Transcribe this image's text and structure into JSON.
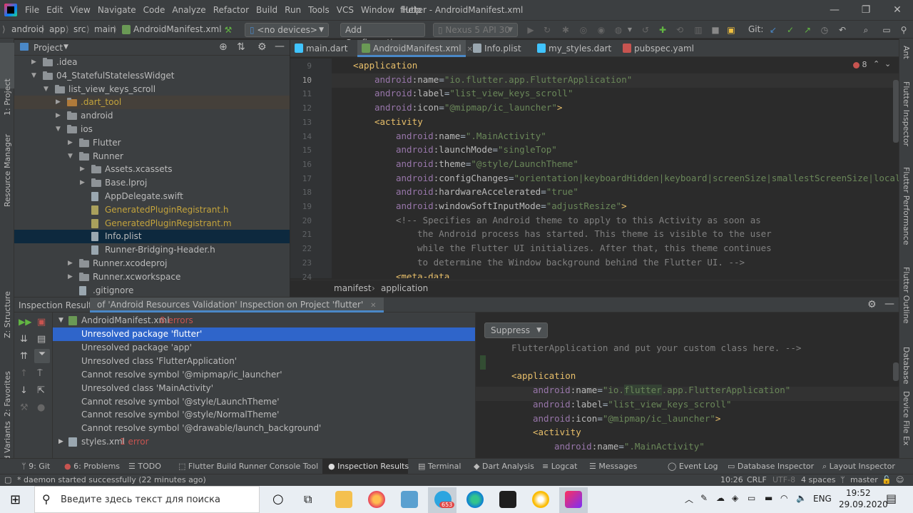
{
  "menubar": {
    "items": [
      "File",
      "Edit",
      "View",
      "Navigate",
      "Code",
      "Analyze",
      "Refactor",
      "Build",
      "Run",
      "Tools",
      "VCS",
      "Window",
      "Help"
    ],
    "title": "flutter - AndroidManifest.xml"
  },
  "navbar": {
    "breadcrumbs": [
      "android",
      "app",
      "src",
      "main",
      "AndroidManifest.xml"
    ],
    "device_select": "<no devices>",
    "add_configuration": "Add Configuration...",
    "emulator": "Nexus 5 API 30",
    "git_label": "Git:"
  },
  "left_strip": {
    "project": "1: Project",
    "resource_manager": "Resource Manager",
    "structure": "Z: Structure",
    "favorites": "2: Favorites",
    "build_variants": "Build Variants"
  },
  "right_strip": {
    "ant": "Ant",
    "flutter_inspector": "Flutter Inspector",
    "flutter_performance": "Flutter Performance",
    "flutter_outline": "Flutter Outline",
    "database": "Database",
    "device_file_explorer": "Device File Ex"
  },
  "project_panel": {
    "title": "Project",
    "tree": [
      {
        "label": ".idea",
        "indent": 0,
        "arrow": ">",
        "type": "folder"
      },
      {
        "label": "04_StatefulStatelessWidget",
        "indent": 0,
        "arrow": "v",
        "type": "folder"
      },
      {
        "label": "list_view_keys_scroll",
        "indent": 1,
        "arrow": "v",
        "type": "folder"
      },
      {
        "label": ".dart_tool",
        "indent": 2,
        "arrow": ">",
        "type": "folder-orange"
      },
      {
        "label": "android",
        "indent": 2,
        "arrow": ">",
        "type": "folder"
      },
      {
        "label": "ios",
        "indent": 2,
        "arrow": "v",
        "type": "folder"
      },
      {
        "label": "Flutter",
        "indent": 3,
        "arrow": ">",
        "type": "folder"
      },
      {
        "label": "Runner",
        "indent": 3,
        "arrow": "v",
        "type": "folder"
      },
      {
        "label": "Assets.xcassets",
        "indent": 4,
        "arrow": ">",
        "type": "folder"
      },
      {
        "label": "Base.lproj",
        "indent": 4,
        "arrow": ">",
        "type": "folder"
      },
      {
        "label": "AppDelegate.swift",
        "indent": 4,
        "arrow": "",
        "type": "file"
      },
      {
        "label": "GeneratedPluginRegistrant.h",
        "indent": 4,
        "arrow": "",
        "type": "file-yellow"
      },
      {
        "label": "GeneratedPluginRegistrant.m",
        "indent": 4,
        "arrow": "",
        "type": "file-yellow"
      },
      {
        "label": "Info.plist",
        "indent": 4,
        "arrow": "",
        "type": "file-selected"
      },
      {
        "label": "Runner-Bridging-Header.h",
        "indent": 4,
        "arrow": "",
        "type": "file"
      },
      {
        "label": "Runner.xcodeproj",
        "indent": 3,
        "arrow": ">",
        "type": "folder"
      },
      {
        "label": "Runner.xcworkspace",
        "indent": 3,
        "arrow": ">",
        "type": "folder"
      },
      {
        "label": ".gitignore",
        "indent": 3,
        "arrow": "",
        "type": "file"
      }
    ]
  },
  "editor_tabs": [
    {
      "label": "main.dart",
      "active": false
    },
    {
      "label": "AndroidManifest.xml",
      "active": true
    },
    {
      "label": "Info.plist",
      "active": false
    },
    {
      "label": "my_styles.dart",
      "active": false
    },
    {
      "label": "pubspec.yaml",
      "active": false
    }
  ],
  "error_count": "8",
  "code_lines": [
    {
      "n": "9",
      "indent": 1,
      "parts": [
        [
          "tag",
          "<application"
        ]
      ]
    },
    {
      "n": "10",
      "indent": 2,
      "parts": [
        [
          "ns",
          "android"
        ],
        [
          "attr",
          ":name"
        ],
        [
          "plain",
          "="
        ],
        [
          "val",
          "\"io.flutter.app.FlutterApplication\""
        ]
      ]
    },
    {
      "n": "11",
      "indent": 2,
      "parts": [
        [
          "ns",
          "android"
        ],
        [
          "attr",
          ":label"
        ],
        [
          "plain",
          "="
        ],
        [
          "val",
          "\"list_view_keys_scroll\""
        ]
      ]
    },
    {
      "n": "12",
      "indent": 2,
      "parts": [
        [
          "ns",
          "android"
        ],
        [
          "attr",
          ":icon"
        ],
        [
          "plain",
          "="
        ],
        [
          "val",
          "\"@mipmap/ic_launcher\""
        ],
        [
          "tag",
          ">"
        ]
      ]
    },
    {
      "n": "13",
      "indent": 2,
      "parts": [
        [
          "tag",
          "<activity"
        ]
      ]
    },
    {
      "n": "14",
      "indent": 3,
      "parts": [
        [
          "ns",
          "android"
        ],
        [
          "attr",
          ":name"
        ],
        [
          "plain",
          "="
        ],
        [
          "val",
          "\".MainActivity\""
        ]
      ]
    },
    {
      "n": "15",
      "indent": 3,
      "parts": [
        [
          "ns",
          "android"
        ],
        [
          "attr",
          ":launchMode"
        ],
        [
          "plain",
          "="
        ],
        [
          "val",
          "\"singleTop\""
        ]
      ]
    },
    {
      "n": "16",
      "indent": 3,
      "parts": [
        [
          "ns",
          "android"
        ],
        [
          "attr",
          ":theme"
        ],
        [
          "plain",
          "="
        ],
        [
          "val",
          "\"@style/LaunchTheme\""
        ]
      ]
    },
    {
      "n": "17",
      "indent": 3,
      "parts": [
        [
          "ns",
          "android"
        ],
        [
          "attr",
          ":configChanges"
        ],
        [
          "plain",
          "="
        ],
        [
          "val",
          "\"orientation|keyboardHidden|keyboard|screenSize|smallestScreenSize|local"
        ]
      ]
    },
    {
      "n": "18",
      "indent": 3,
      "parts": [
        [
          "ns",
          "android"
        ],
        [
          "attr",
          ":hardwareAccelerated"
        ],
        [
          "plain",
          "="
        ],
        [
          "val",
          "\"true\""
        ]
      ]
    },
    {
      "n": "19",
      "indent": 3,
      "parts": [
        [
          "ns",
          "android"
        ],
        [
          "attr",
          ":windowSoftInputMode"
        ],
        [
          "plain",
          "="
        ],
        [
          "val",
          "\"adjustResize\""
        ],
        [
          "tag",
          ">"
        ]
      ]
    },
    {
      "n": "20",
      "indent": 3,
      "parts": [
        [
          "cmt",
          "<!-- Specifies an Android theme to apply to this Activity as soon as"
        ]
      ]
    },
    {
      "n": "21",
      "indent": 4,
      "parts": [
        [
          "cmt",
          "the Android process has started. This theme is visible to the user"
        ]
      ]
    },
    {
      "n": "22",
      "indent": 4,
      "parts": [
        [
          "cmt",
          "while the Flutter UI initializes. After that, this theme continues"
        ]
      ]
    },
    {
      "n": "23",
      "indent": 4,
      "parts": [
        [
          "cmt",
          "to determine the Window background behind the Flutter UI. -->"
        ]
      ]
    },
    {
      "n": "24",
      "indent": 3,
      "parts": [
        [
          "tag",
          "<meta-data"
        ]
      ]
    }
  ],
  "editor_crumbs": [
    "manifest",
    "application"
  ],
  "inspection": {
    "label": "Inspection Results:",
    "tab": "of 'Android Resources Validation' Inspection on Project 'flutter'",
    "file1": "AndroidManifest.xml",
    "file1_count": "8 errors",
    "items": [
      "Unresolved package 'flutter'",
      "Unresolved package 'app'",
      "Unresolved class 'FlutterApplication'",
      "Cannot resolve symbol '@mipmap/ic_launcher'",
      "Unresolved class 'MainActivity'",
      "Cannot resolve symbol '@style/LaunchTheme'",
      "Cannot resolve symbol '@style/NormalTheme'",
      "Cannot resolve symbol '@drawable/launch_background'"
    ],
    "file2": "styles.xml",
    "file2_count": "1 error",
    "suppress": "Suppress"
  },
  "preview_lines": [
    {
      "indent": 1,
      "parts": [
        [
          "cmt",
          "FlutterApplication and put your custom class here. -->"
        ]
      ]
    },
    {
      "indent": 0,
      "parts": [
        [
          "plain",
          ""
        ]
      ]
    },
    {
      "indent": 1,
      "parts": [
        [
          "tag",
          "<application"
        ]
      ]
    },
    {
      "indent": 2,
      "parts": [
        [
          "ns",
          "android"
        ],
        [
          "attr",
          ":name"
        ],
        [
          "plain",
          "="
        ],
        [
          "val",
          "\"io."
        ],
        [
          "hl",
          "flutter"
        ],
        [
          "val",
          ".app.FlutterApplication\""
        ]
      ]
    },
    {
      "indent": 2,
      "parts": [
        [
          "ns",
          "android"
        ],
        [
          "attr",
          ":label"
        ],
        [
          "plain",
          "="
        ],
        [
          "val",
          "\"list_view_keys_scroll\""
        ]
      ]
    },
    {
      "indent": 2,
      "parts": [
        [
          "ns",
          "android"
        ],
        [
          "attr",
          ":icon"
        ],
        [
          "plain",
          "="
        ],
        [
          "val",
          "\"@mipmap/ic_launcher\""
        ],
        [
          "tag",
          ">"
        ]
      ]
    },
    {
      "indent": 2,
      "parts": [
        [
          "tag",
          "<activity"
        ]
      ]
    },
    {
      "indent": 3,
      "parts": [
        [
          "ns",
          "android"
        ],
        [
          "attr",
          ":name"
        ],
        [
          "plain",
          "="
        ],
        [
          "val",
          "\".MainActivity\""
        ]
      ]
    }
  ],
  "bottom_tabs": [
    {
      "label": "9: Git"
    },
    {
      "label": "6: Problems"
    },
    {
      "label": "TODO"
    },
    {
      "label": "Flutter Build Runner Console Tool"
    },
    {
      "label": "Inspection Results",
      "active": true
    },
    {
      "label": "Terminal"
    },
    {
      "label": "Dart Analysis"
    },
    {
      "label": "Logcat"
    },
    {
      "label": "Messages"
    },
    {
      "label": "Event Log"
    },
    {
      "label": "Database Inspector"
    },
    {
      "label": "Layout Inspector"
    }
  ],
  "status": {
    "message": "* daemon started successfully (22 minutes ago)",
    "position": "10:26",
    "line_sep": "CRLF",
    "encoding": "UTF-8",
    "indent": "4 spaces",
    "branch": "master"
  },
  "taskbar": {
    "search_placeholder": "Введите здесь текст для поиска",
    "lang": "ENG",
    "time": "19:52",
    "date": "29.09.2020",
    "telegram_badge": "653"
  }
}
